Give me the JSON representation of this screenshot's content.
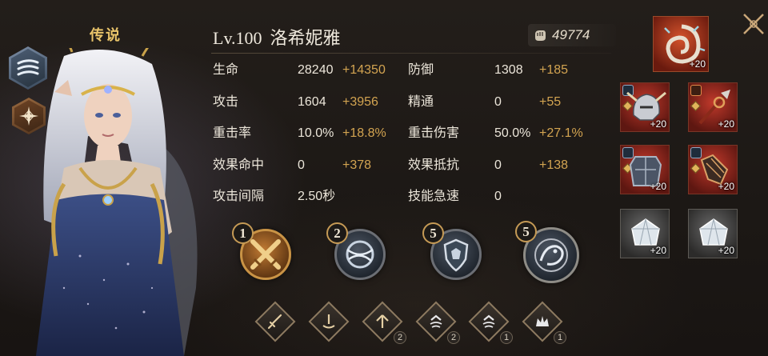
{
  "hero": {
    "rarity": "传说",
    "level": "Lv.100",
    "name": "洛希妮雅",
    "power": "49774"
  },
  "stats_left": [
    {
      "name": "生命",
      "base": "28240",
      "bonus": "+14350"
    },
    {
      "name": "攻击",
      "base": "1604",
      "bonus": "+3956"
    },
    {
      "name": "重击率",
      "base": "10.0%",
      "bonus": "+18.8%"
    },
    {
      "name": "效果命中",
      "base": "0",
      "bonus": "+378"
    },
    {
      "name": "攻击间隔",
      "base": "2.50秒",
      "bonus": ""
    }
  ],
  "stats_right": [
    {
      "name": "防御",
      "base": "1308",
      "bonus": "+185"
    },
    {
      "name": "精通",
      "base": "0",
      "bonus": "+55"
    },
    {
      "name": "重击伤害",
      "base": "50.0%",
      "bonus": "+27.1%"
    },
    {
      "name": "效果抵抗",
      "base": "0",
      "bonus": "+138"
    },
    {
      "name": "技能急速",
      "base": "0",
      "bonus": ""
    }
  ],
  "skills": [
    {
      "level": "1",
      "icon": "crossed-swords-icon"
    },
    {
      "level": "2",
      "icon": "wind-orb-icon"
    },
    {
      "level": "5",
      "icon": "beast-shield-icon"
    },
    {
      "level": "5",
      "icon": "dragon-ultimate-icon"
    }
  ],
  "runes": [
    {
      "icon": "sword-rune-icon",
      "count": ""
    },
    {
      "icon": "pillar-rune-icon",
      "count": ""
    },
    {
      "icon": "arrow-up-rune-icon",
      "count": "2"
    },
    {
      "icon": "speed-rune-icon",
      "count": "2"
    },
    {
      "icon": "speed-rune-icon",
      "count": "1"
    },
    {
      "icon": "crown-rune-icon",
      "count": "1"
    }
  ],
  "equipment": {
    "artifact": {
      "icon": "nautilus-shell-icon",
      "enhance": "+20"
    },
    "slots": [
      {
        "icon": "dragon-helmet-icon",
        "enhance": "+20"
      },
      {
        "icon": "spear-weapon-icon",
        "enhance": "+20"
      },
      {
        "icon": "armor-chest-icon",
        "enhance": "+20"
      },
      {
        "icon": "gauntlet-icon",
        "enhance": "+20"
      },
      {
        "icon": "crystal-gem-icon",
        "enhance": "+20"
      },
      {
        "icon": "crystal-gem-icon",
        "enhance": "+20"
      }
    ]
  },
  "colors": {
    "gold_text": "#e9c46a",
    "bonus": "#d3a451",
    "equipment_legendary": "#c0392b"
  }
}
